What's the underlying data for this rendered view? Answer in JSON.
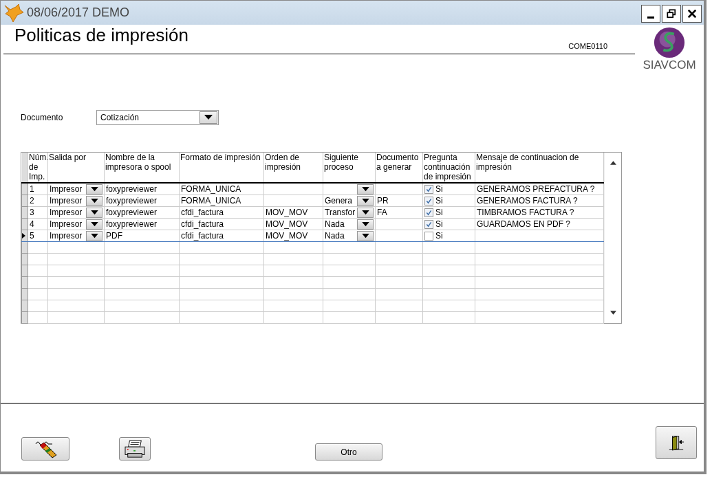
{
  "window": {
    "title": "08/06/2017  DEMO"
  },
  "header": {
    "title": "Politicas de impresión",
    "code": "COME0110",
    "logo_text": "SIAVCOM"
  },
  "documento": {
    "label": "Documento",
    "value": "Cotización"
  },
  "table": {
    "columns": [
      "Núm. de Imp.",
      "Salida por",
      "Nombre de la impresora o spool",
      "Formato de impresión",
      "Orden de impresión",
      "Siguiente proceso",
      "Documento a  generar",
      "Pregunta continuación de impresión",
      "Mensaje de continuacion de impresión"
    ],
    "rows": [
      {
        "num": "1",
        "salida": "Impresor",
        "nombre": "foxypreviewer",
        "formato": "FORMA_UNICA",
        "orden": "",
        "siguiente": "",
        "documento": "",
        "pregunta": {
          "checked": true,
          "label": "Si"
        },
        "mensaje": "GENERAMOS PREFACTURA ?",
        "selected": false
      },
      {
        "num": "2",
        "salida": "Impresor",
        "nombre": "foxypreviewer",
        "formato": "FORMA_UNICA",
        "orden": "",
        "siguiente": "Genera",
        "documento": "PR",
        "pregunta": {
          "checked": true,
          "label": "Si"
        },
        "mensaje": "GENERAMOS FACTURA ?",
        "selected": false
      },
      {
        "num": "3",
        "salida": "Impresor",
        "nombre": "foxypreviewer",
        "formato": "cfdi_factura",
        "orden": "MOV_MOV",
        "siguiente": "Transfor",
        "documento": "FA",
        "pregunta": {
          "checked": true,
          "label": "Si"
        },
        "mensaje": "TIMBRAMOS FACTURA ?",
        "selected": false
      },
      {
        "num": "4",
        "salida": "Impresor",
        "nombre": "foxypreviewer",
        "formato": "cfdi_factura",
        "orden": "MOV_MOV",
        "siguiente": "Nada",
        "documento": "",
        "pregunta": {
          "checked": true,
          "label": "Si"
        },
        "mensaje": "GUARDAMOS EN PDF ?",
        "selected": false
      },
      {
        "num": "5",
        "salida": "Impresor",
        "nombre": "PDF",
        "formato": "cfdi_factura",
        "orden": "MOV_MOV",
        "siguiente": "Nada",
        "documento": "",
        "pregunta": {
          "checked": false,
          "label": "Si"
        },
        "mensaje": "",
        "selected": true
      }
    ]
  },
  "buttons": {
    "otro": "Otro"
  }
}
